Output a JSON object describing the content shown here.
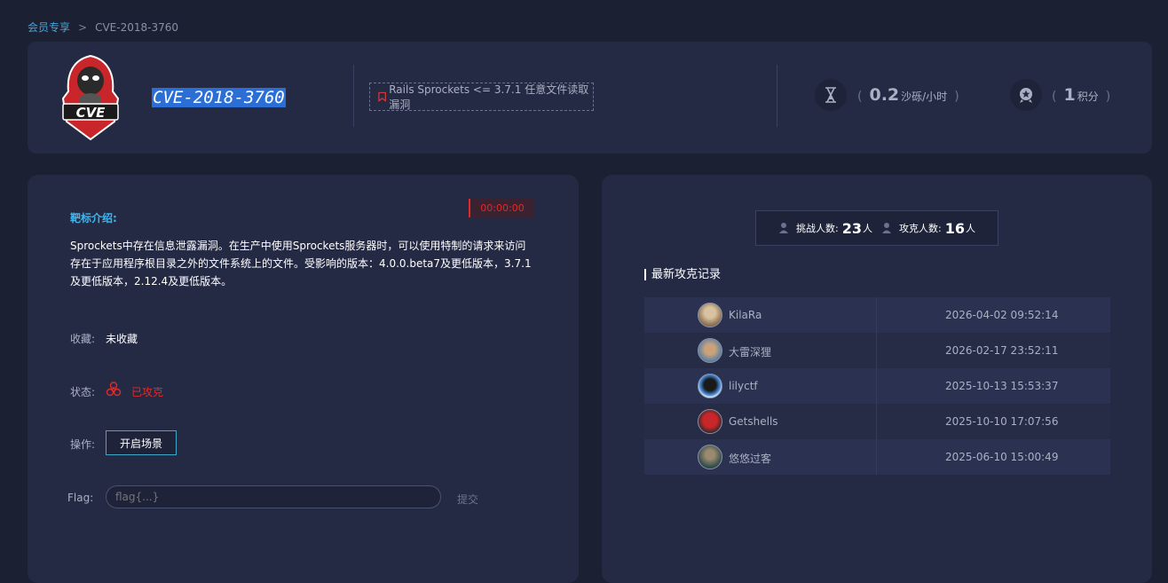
{
  "breadcrumb": {
    "home": "会员专享",
    "separator": ">",
    "current": "CVE-2018-3760"
  },
  "header": {
    "logo_text": "CVE",
    "title": "CVE-2018-3760",
    "vuln_tag": "Rails Sprockets <= 3.7.1 任意文件读取漏洞",
    "hourglass_stat": {
      "open": "(",
      "value": "0.2",
      "unit": "沙砾/小时",
      "close": ")"
    },
    "points_stat": {
      "open": "(",
      "value": "1",
      "unit": "积分",
      "close": ")"
    }
  },
  "left": {
    "intro_title": "靶标介绍:",
    "timer": "00:00:00",
    "description": "Sprockets中存在信息泄露漏洞。在生产中使用Sprockets服务器时，可以使用特制的请求来访问存在于应用程序根目录之外的文件系统上的文件。受影响的版本：4.0.0.beta7及更低版本，3.7.1及更低版本，2.12.4及更低版本。",
    "favorite_label": "收藏:",
    "favorite_value": "未收藏",
    "status_label": "状态:",
    "status_value": "已攻克",
    "action_label": "操作:",
    "start_button": "开启场景",
    "flag_label": "Flag:",
    "flag_placeholder": "flag{...}",
    "submit_label": "提交"
  },
  "right": {
    "challengers_label": "挑战人数:",
    "challengers_count": "23",
    "challengers_unit": "人",
    "solvers_label": "攻克人数:",
    "solvers_count": "16",
    "solvers_unit": "人",
    "records_title": "最新攻克记录",
    "records": [
      {
        "name": "KilaRa",
        "time": "2026-04-02 09:52:14"
      },
      {
        "name": "大雷深狸",
        "time": "2026-02-17 23:52:11"
      },
      {
        "name": "lilyctf",
        "time": "2025-10-13 15:53:37"
      },
      {
        "name": "Getshells",
        "time": "2025-10-10 17:07:56"
      },
      {
        "name": "悠悠过客",
        "time": "2025-06-10 15:00:49"
      }
    ]
  },
  "colors": {
    "background": "#1c2033",
    "card": "#252a44",
    "accent_blue": "#3fb6f0",
    "danger_red": "#e02a2a"
  },
  "icons": [
    "shield-cve-logo",
    "bookmark-icon",
    "hourglass-icon",
    "medal-icon",
    "person-icon",
    "biohazard-icon"
  ]
}
